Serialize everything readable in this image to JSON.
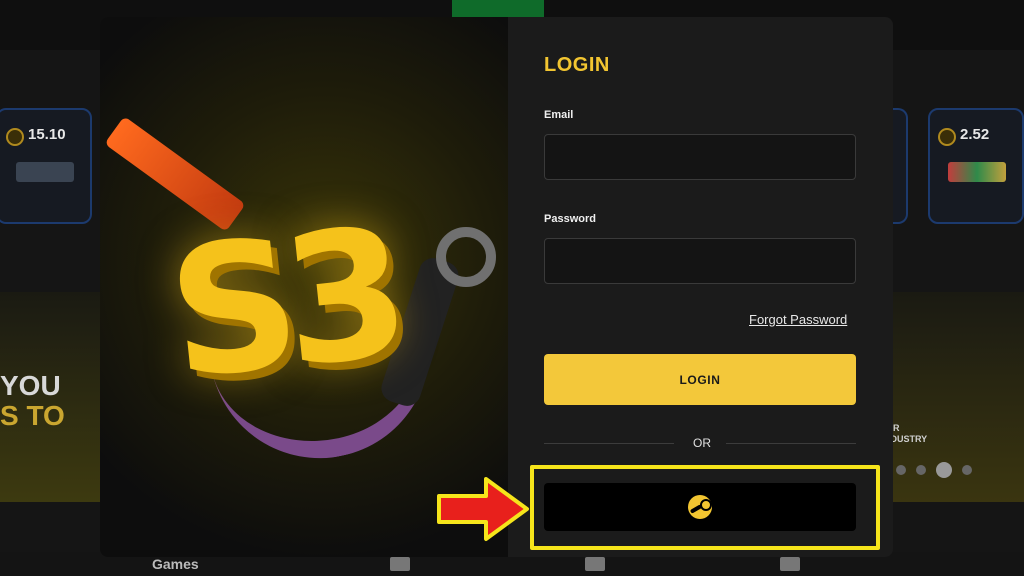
{
  "background": {
    "price_cards": [
      {
        "price": "15.10"
      },
      {
        "price": "2.52"
      }
    ],
    "banner_left": {
      "line1": "YOU",
      "line2": "S TO"
    },
    "banner_right": {
      "line1": "AIR",
      "line2": "NDUSTRY"
    },
    "bottom_nav": {
      "games_label": "Games"
    }
  },
  "login": {
    "title": "LOGIN",
    "email_label": "Email",
    "email_value": "",
    "password_label": "Password",
    "password_value": "",
    "forgot_password": "Forgot Password",
    "login_button": "LOGIN",
    "or_text": "OR",
    "steam_icon": "steam-icon"
  },
  "art": {
    "logo_text": "S3"
  },
  "colors": {
    "accent": "#f3c83a",
    "panel": "#1b1b1b",
    "highlight": "#f6e51b",
    "arrow": "#e8201c"
  }
}
